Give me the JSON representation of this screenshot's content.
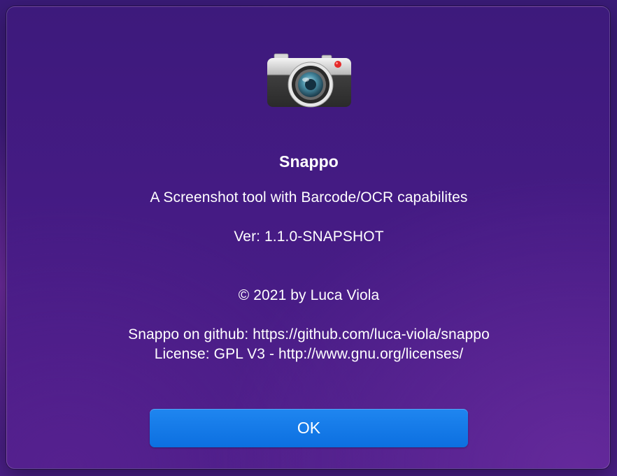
{
  "dialog": {
    "icon": "camera-icon",
    "app_name": "Snappo",
    "tagline": "A Screenshot tool with Barcode/OCR capabilites",
    "version": "Ver: 1.1.0-SNAPSHOT",
    "copyright": "© 2021 by Luca Viola",
    "github": "Snappo on github: https://github.com/luca-viola/snappo",
    "license": "License: GPL V3 - http://www.gnu.org/licenses/",
    "ok_label": "OK"
  },
  "colors": {
    "background": "#451b84",
    "button": "#1479e8",
    "text": "#ffffff"
  }
}
